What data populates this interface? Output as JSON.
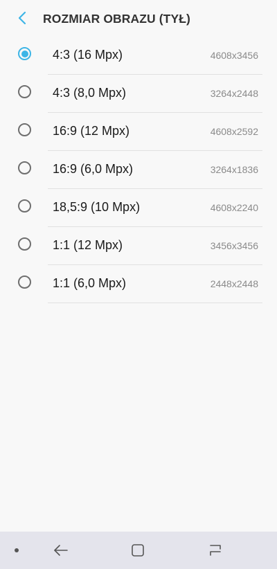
{
  "header": {
    "title": "ROZMIAR OBRAZU (TYŁ)",
    "back_icon": "chevron-left-icon",
    "accent_color": "#3db5e6"
  },
  "options": [
    {
      "label": "4:3 (16 Mpx)",
      "resolution": "4608x3456",
      "selected": true
    },
    {
      "label": "4:3 (8,0 Mpx)",
      "resolution": "3264x2448",
      "selected": false
    },
    {
      "label": "16:9 (12 Mpx)",
      "resolution": "4608x2592",
      "selected": false
    },
    {
      "label": "16:9 (6,0 Mpx)",
      "resolution": "3264x1836",
      "selected": false
    },
    {
      "label": "18,5:9 (10 Mpx)",
      "resolution": "4608x2240",
      "selected": false
    },
    {
      "label": "1:1 (12 Mpx)",
      "resolution": "3456x3456",
      "selected": false
    },
    {
      "label": "1:1 (6,0 Mpx)",
      "resolution": "2448x2448",
      "selected": false
    }
  ],
  "navbar": {
    "icons": [
      "dot-icon",
      "back-arrow-icon",
      "home-square-icon",
      "recents-icon"
    ]
  }
}
